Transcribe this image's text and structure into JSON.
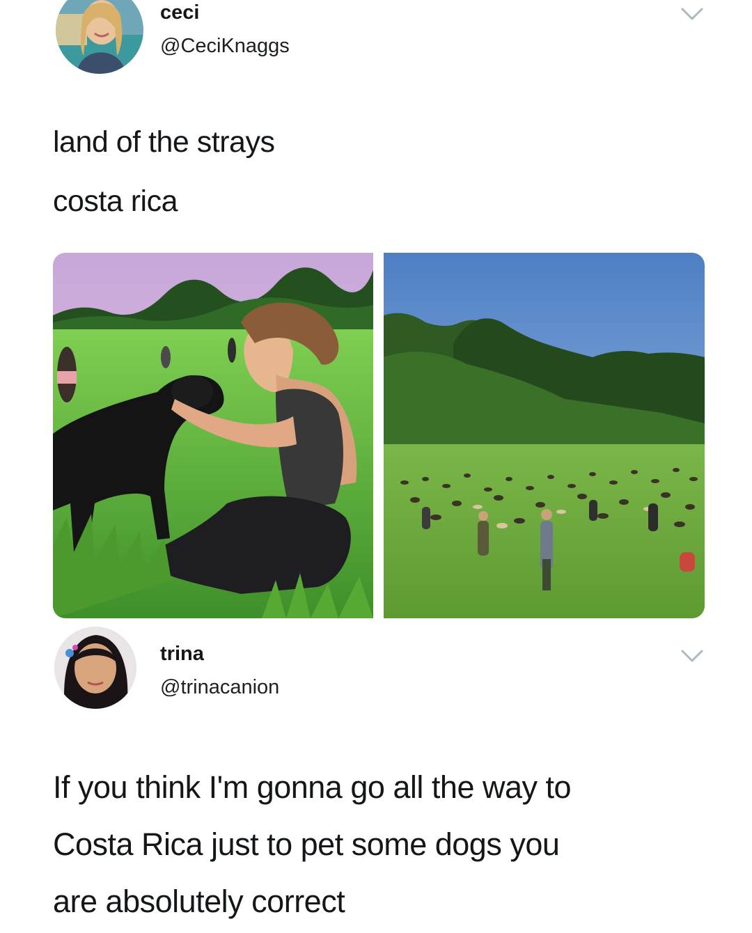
{
  "tweets": [
    {
      "display_name": "ceci",
      "handle": "@CeciKnaggs",
      "text_lines": [
        "land of the strays",
        "costa rica"
      ],
      "icons": {
        "menu": "chevron-down-icon"
      }
    },
    {
      "display_name": "trina",
      "handle": "@trinacanion",
      "text_lines": [
        "If you think I'm gonna go all the way to",
        "Costa Rica just to pet some dogs you",
        "are absolutely correct"
      ],
      "icons": {
        "menu": "chevron-down-icon"
      }
    }
  ],
  "colors": {
    "text": "#14171a",
    "chevron": "#aab8c2",
    "background": "#ffffff"
  }
}
